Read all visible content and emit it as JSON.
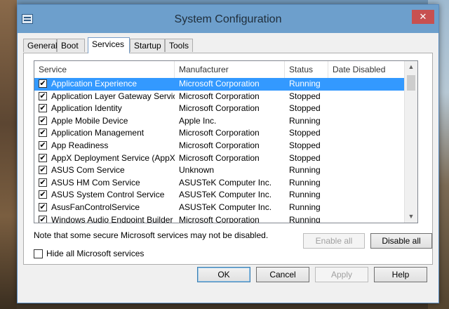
{
  "window": {
    "title": "System Configuration",
    "close_glyph": "✕"
  },
  "tabs": [
    {
      "label": "General",
      "active": false
    },
    {
      "label": "Boot",
      "active": false
    },
    {
      "label": "Services",
      "active": true
    },
    {
      "label": "Startup",
      "active": false
    },
    {
      "label": "Tools",
      "active": false
    }
  ],
  "table": {
    "columns": [
      "Service",
      "Manufacturer",
      "Status",
      "Date Disabled"
    ],
    "rows": [
      {
        "checked": true,
        "service": "Application Experience",
        "manufacturer": "Microsoft Corporation",
        "status": "Running",
        "date_disabled": "",
        "selected": true
      },
      {
        "checked": true,
        "service": "Application Layer Gateway Service",
        "manufacturer": "Microsoft Corporation",
        "status": "Stopped",
        "date_disabled": ""
      },
      {
        "checked": true,
        "service": "Application Identity",
        "manufacturer": "Microsoft Corporation",
        "status": "Stopped",
        "date_disabled": ""
      },
      {
        "checked": true,
        "service": "Apple Mobile Device",
        "manufacturer": "Apple Inc.",
        "status": "Running",
        "date_disabled": ""
      },
      {
        "checked": true,
        "service": "Application Management",
        "manufacturer": "Microsoft Corporation",
        "status": "Stopped",
        "date_disabled": ""
      },
      {
        "checked": true,
        "service": "App Readiness",
        "manufacturer": "Microsoft Corporation",
        "status": "Stopped",
        "date_disabled": ""
      },
      {
        "checked": true,
        "service": "AppX Deployment Service (AppX...",
        "manufacturer": "Microsoft Corporation",
        "status": "Stopped",
        "date_disabled": ""
      },
      {
        "checked": true,
        "service": "ASUS Com Service",
        "manufacturer": "Unknown",
        "status": "Running",
        "date_disabled": ""
      },
      {
        "checked": true,
        "service": "ASUS HM Com Service",
        "manufacturer": "ASUSTeK Computer Inc.",
        "status": "Running",
        "date_disabled": ""
      },
      {
        "checked": true,
        "service": "ASUS System Control Service",
        "manufacturer": "ASUSTeK Computer Inc.",
        "status": "Running",
        "date_disabled": ""
      },
      {
        "checked": true,
        "service": "AsusFanControlService",
        "manufacturer": "ASUSTeK Computer Inc.",
        "status": "Running",
        "date_disabled": ""
      },
      {
        "checked": true,
        "service": "Windows Audio Endpoint Builder",
        "manufacturer": "Microsoft Corporation",
        "status": "Running",
        "date_disabled": ""
      }
    ]
  },
  "note": "Note that some secure Microsoft services may not be disabled.",
  "enable_all": {
    "label": "Enable all",
    "enabled": false
  },
  "disable_all": {
    "label": "Disable all",
    "enabled": true
  },
  "hide_ms": {
    "label": "Hide all Microsoft services",
    "checked": false
  },
  "buttons": {
    "ok": "OK",
    "cancel": "Cancel",
    "apply": "Apply",
    "help": "Help"
  },
  "colors": {
    "selection": "#3399ff",
    "titlebar": "#6d9fcc",
    "close": "#c75050"
  }
}
